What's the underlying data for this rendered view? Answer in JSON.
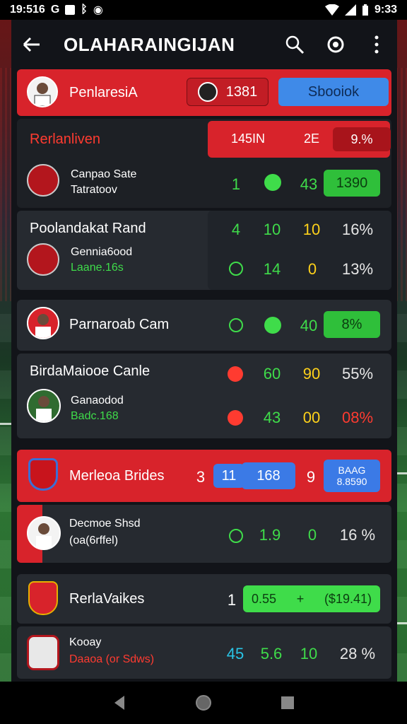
{
  "status": {
    "time_left": "19:516",
    "time_right": "9:33"
  },
  "app": {
    "title": "OLAHARAINGIJAN"
  },
  "top_card": {
    "name": "PenlaresiA",
    "score": "1381",
    "button_label": "Sbooiok"
  },
  "section1": {
    "title": "Rerlanliven",
    "stats": [
      "145IN",
      "2E",
      "9.%"
    ]
  },
  "rows": [
    {
      "title": "Canpao Sate",
      "sub": "Tatratoov",
      "v1": "1",
      "v2": "43",
      "pill": "1390"
    },
    {
      "title": "Poolandakat Rand",
      "sub": ""
    },
    {
      "title": "Gennia6ood",
      "sub": "Laane.16s",
      "r1": [
        "4",
        "10",
        "10",
        "16%"
      ],
      "r2": [
        "14",
        "0",
        "13%"
      ]
    },
    {
      "title": "Parnaroab Cam",
      "v1": "40",
      "pill": "8%"
    },
    {
      "title": "BirdaMaiooe Canle",
      "r1": [
        "60",
        "90",
        "55%"
      ]
    },
    {
      "title": "Ganaodod",
      "sub": "Badc.168",
      "r2": [
        "43",
        "00",
        "08%"
      ]
    },
    {
      "title": "Merleoa Brides",
      "a": "3",
      "b": "11",
      "c": "168",
      "d": "9",
      "pill_top": "BAAG",
      "pill_bottom": "8.8590"
    },
    {
      "title": "Decmoe Shsd",
      "sub": "(oa(6rffel)",
      "v1": "1.9",
      "v2": "0",
      "v3": "16 %"
    },
    {
      "title": "RerlaVaikes",
      "a": "1",
      "pill_left": "0.55",
      "pill_mid": "+",
      "pill_right": "($19.41)"
    },
    {
      "title": "Kooay",
      "sub": "Daaoa (or Sdws)",
      "v1": "45",
      "v2": "5.6",
      "v3": "10",
      "v4": "28 %"
    }
  ],
  "colors": {
    "accent_red": "#d8232b",
    "accent_blue": "#3b7ae6",
    "positive": "#3fdc4a",
    "warning": "#ffd21a"
  }
}
